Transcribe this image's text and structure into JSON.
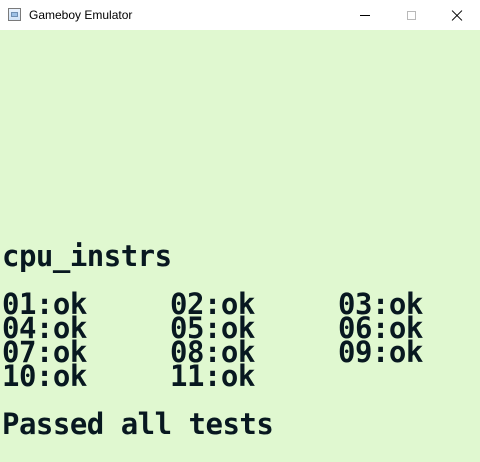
{
  "window": {
    "title": "Gameboy Emulator",
    "icon": "app-window-icon",
    "controls": {
      "minimize_icon": "minimize-icon",
      "maximize_icon": "maximize-icon",
      "close_icon": "close-icon"
    }
  },
  "screen": {
    "background_color": "#e0f8d0",
    "text_color": "#081820",
    "heading": "cpu_instrs",
    "results": [
      [
        "01:ok",
        "02:ok",
        "03:ok"
      ],
      [
        "04:ok",
        "05:ok",
        "06:ok"
      ],
      [
        "07:ok",
        "08:ok",
        "09:ok"
      ],
      [
        "10:ok",
        "11:ok"
      ]
    ],
    "footer": "Passed all tests"
  }
}
